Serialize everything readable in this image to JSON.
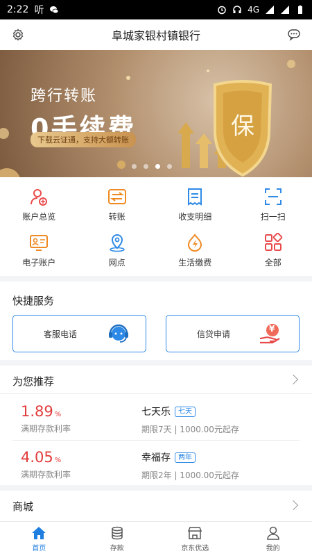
{
  "status": {
    "time": "2:22",
    "extras": [
      "听"
    ],
    "network": "4G"
  },
  "header": {
    "title": "阜城家银村镇银行"
  },
  "banner": {
    "line1": "跨行转账",
    "line2": "0手续费",
    "line3": "下载云证通，支持大额转账",
    "emblem": "保",
    "dots": 4,
    "active_dot": 2
  },
  "grid": [
    {
      "label": "账户总览",
      "icon": "account-overview-icon",
      "color": "#e94b4b"
    },
    {
      "label": "转账",
      "icon": "transfer-icon",
      "color": "#f08a24"
    },
    {
      "label": "收支明细",
      "icon": "statement-icon",
      "color": "#2e8ae6"
    },
    {
      "label": "扫一扫",
      "icon": "scan-icon",
      "color": "#2e8ae6"
    },
    {
      "label": "电子账户",
      "icon": "e-account-icon",
      "color": "#f08a24"
    },
    {
      "label": "网点",
      "icon": "branch-location-icon",
      "color": "#2e8ae6"
    },
    {
      "label": "生活缴费",
      "icon": "utility-payment-icon",
      "color": "#f08a24"
    },
    {
      "label": "全部",
      "icon": "all-apps-icon",
      "color": "#e94b4b"
    }
  ],
  "quick": {
    "title": "快捷服务",
    "items": [
      {
        "label": "客服电话",
        "icon": "customer-service-icon"
      },
      {
        "label": "信贷申请",
        "icon": "loan-apply-icon",
        "symbol": "¥"
      }
    ]
  },
  "recommend": {
    "title": "为您推荐",
    "items": [
      {
        "rate": "1.89",
        "pct": "%",
        "rate_label": "满期存款利率",
        "name": "七天乐",
        "tag": "七天",
        "desc": "期限7天  |  1000.00元起存"
      },
      {
        "rate": "4.05",
        "pct": "%",
        "rate_label": "满期存款利率",
        "name": "幸福存",
        "tag": "两年",
        "desc": "期限2年  |  1000.00元起存"
      }
    ]
  },
  "mall": {
    "title": "商城"
  },
  "tabs": [
    {
      "label": "首页",
      "icon": "home-icon",
      "active": true
    },
    {
      "label": "存款",
      "icon": "deposit-icon",
      "active": false
    },
    {
      "label": "京东优选",
      "icon": "shop-icon",
      "active": false
    },
    {
      "label": "我的",
      "icon": "profile-icon",
      "active": false
    }
  ],
  "colors": {
    "accent": "#2e8ae6",
    "rate": "#e23b3b",
    "tab_active": "#1f7fe0"
  }
}
